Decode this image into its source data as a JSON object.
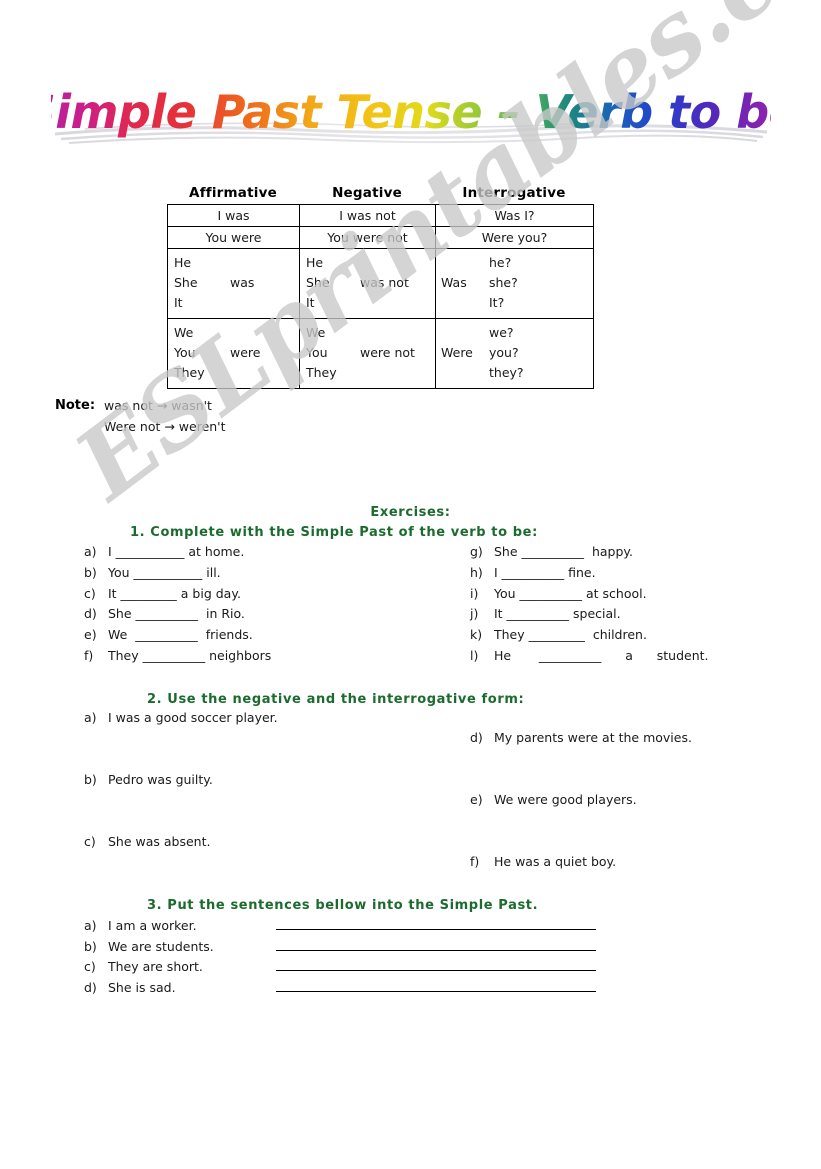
{
  "title": {
    "text": "Simple Past Tense – Verb to be",
    "letters": [
      {
        "ch": "S",
        "color": "#a02ca8"
      },
      {
        "ch": "i",
        "color": "#b31fa0"
      },
      {
        "ch": "m",
        "color": "#c91d8f"
      },
      {
        "ch": "p",
        "color": "#d9206e"
      },
      {
        "ch": "l",
        "color": "#e02850"
      },
      {
        "ch": "e",
        "color": "#e53238"
      },
      {
        "ch": " ",
        "color": "#e53238"
      },
      {
        "ch": "P",
        "color": "#ea4b22"
      },
      {
        "ch": "a",
        "color": "#ef6a1c"
      },
      {
        "ch": "s",
        "color": "#f08a1a"
      },
      {
        "ch": "t",
        "color": "#f2a718"
      },
      {
        "ch": " ",
        "color": "#f2a718"
      },
      {
        "ch": "T",
        "color": "#f3c316"
      },
      {
        "ch": "e",
        "color": "#eed519"
      },
      {
        "ch": "n",
        "color": "#d9dc1c"
      },
      {
        "ch": "s",
        "color": "#b5d227"
      },
      {
        "ch": "e",
        "color": "#86c63f"
      },
      {
        "ch": " ",
        "color": "#86c63f"
      },
      {
        "ch": "–",
        "color": "#5cba52"
      },
      {
        "ch": " ",
        "color": "#5cba52"
      },
      {
        "ch": "V",
        "color": "#1e8a7a"
      },
      {
        "ch": "e",
        "color": "#1a74a8"
      },
      {
        "ch": "r",
        "color": "#1f5fc0"
      },
      {
        "ch": "b",
        "color": "#2540cc"
      },
      {
        "ch": " ",
        "color": "#2540cc"
      },
      {
        "ch": "t",
        "color": "#3a2ec4"
      },
      {
        "ch": "o",
        "color": "#5527bb"
      },
      {
        "ch": " ",
        "color": "#5527bb"
      },
      {
        "ch": "b",
        "color": "#7a25b3"
      },
      {
        "ch": "e",
        "color": "#9b22ac"
      }
    ]
  },
  "watermark": {
    "text": "ESLprintables.com",
    "color": "#c9c9c9"
  },
  "table": {
    "headers": [
      "Affirmative",
      "Negative",
      "Interrogative"
    ],
    "row_i": {
      "affirmative": "I was",
      "negative": "I was not",
      "interrogative": "Was I?"
    },
    "row_you": {
      "affirmative": "You were",
      "negative": "You were not",
      "interrogative": "Were you?"
    },
    "row_he": {
      "pronouns": [
        "He",
        "She",
        "It"
      ],
      "aff_verb": "was",
      "neg_verb": "was not",
      "q_word": "Was",
      "q_pronouns": [
        "he?",
        "she?",
        "It?"
      ]
    },
    "row_we": {
      "pronouns": [
        "We",
        "You",
        "They"
      ],
      "aff_verb": "were",
      "neg_verb": "were not",
      "q_word": "Were",
      "q_pronouns": [
        "we?",
        "you?",
        "they?"
      ]
    }
  },
  "note": {
    "label": "Note:",
    "line1": "was not  → wasn't",
    "line2": "Were not → weren't"
  },
  "exercises": {
    "heading": "Exercises:",
    "green_color": "#1c6b2e",
    "ex1": {
      "heading": "1.  Complete with the Simple Past of the verb to be:",
      "left": [
        {
          "label": "a)",
          "text": "I ___________ at home."
        },
        {
          "label": "b)",
          "text": "You ___________ ill."
        },
        {
          "label": "c)",
          "text": "It _________ a big day."
        },
        {
          "label": "d)",
          "text": "She __________  in Rio."
        },
        {
          "label": "e)",
          "text": "We  __________  friends."
        },
        {
          "label": "f)",
          "text": "They __________ neighbors"
        }
      ],
      "right": [
        {
          "label": "g)",
          "text": "She __________  happy."
        },
        {
          "label": "h)",
          "text": "I __________ fine."
        },
        {
          "label": "i)",
          "text": "You __________ at school."
        },
        {
          "label": "j)",
          "text": "It __________ special."
        },
        {
          "label": "k)",
          "text": "They _________  children."
        },
        {
          "label": "l)",
          "text": "He       __________      a      student."
        }
      ]
    },
    "ex2": {
      "heading": "2.  Use the negative and the interrogative form:",
      "left": [
        {
          "label": "a)",
          "text": "I was a good soccer player."
        },
        {
          "label": "b)",
          "text": "Pedro was guilty."
        },
        {
          "label": "c)",
          "text": "She was absent."
        }
      ],
      "right": [
        {
          "label": "d)",
          "text": "My parents were at the movies."
        },
        {
          "label": "e)",
          "text": "We were good players."
        },
        {
          "label": "f)",
          "text": "He was a quiet boy."
        }
      ]
    },
    "ex3": {
      "heading": "3.  Put the sentences bellow into the Simple Past.",
      "items": [
        {
          "label": "a)",
          "text": "I am a worker."
        },
        {
          "label": "b)",
          "text": "We are students."
        },
        {
          "label": "c)",
          "text": "They are short."
        },
        {
          "label": "d)",
          "text": "She is sad."
        }
      ]
    }
  }
}
